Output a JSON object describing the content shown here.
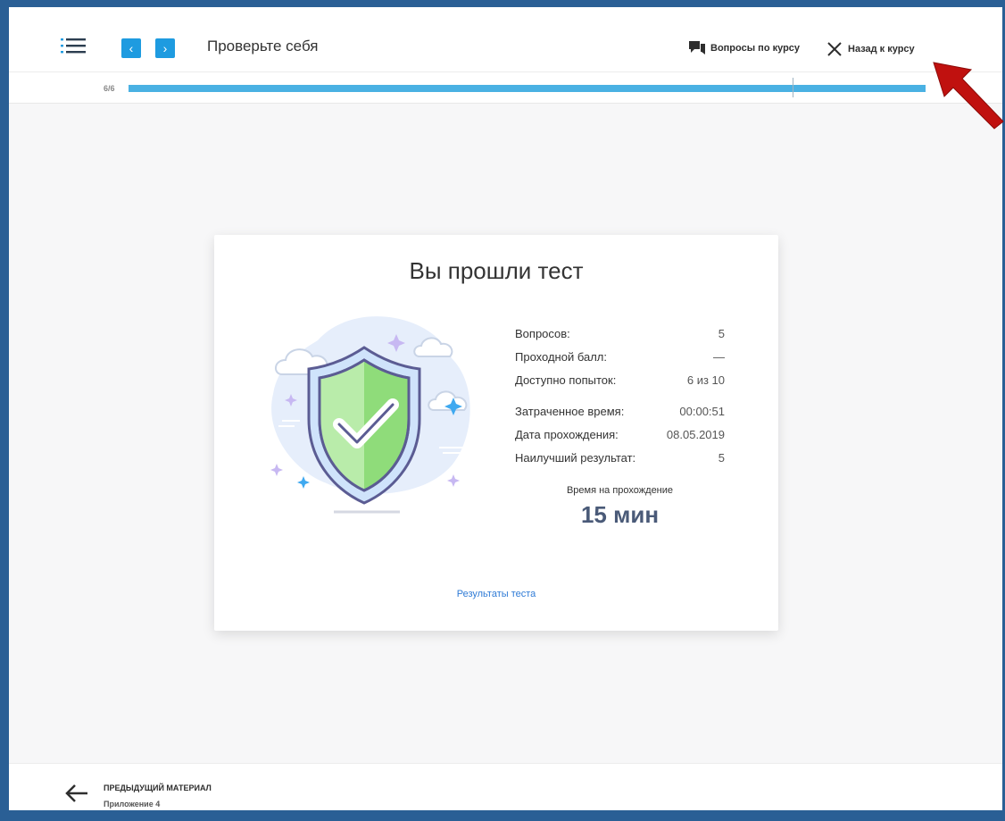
{
  "header": {
    "title": "Проверьте себя",
    "questions_label": "Вопросы по курсу",
    "back_label": "Назад к курсу"
  },
  "progress": {
    "label": "6/6",
    "fraction": 1.0,
    "color": "#4ab1e3"
  },
  "result": {
    "title": "Вы прошли тест",
    "stats": [
      {
        "label": "Вопросов:",
        "value": "5"
      },
      {
        "label": "Проходной балл:",
        "value": "—"
      },
      {
        "label": "Доступно попыток:",
        "value": "6 из 10"
      },
      {
        "label": "Затраченное время:",
        "value": "00:00:51"
      },
      {
        "label": "Дата прохождения:",
        "value": "08.05.2019"
      },
      {
        "label": "Наилучший результат:",
        "value": "5"
      }
    ],
    "time_caption": "Время на прохождение",
    "time_value": "15 мин",
    "results_link": "Результаты теста"
  },
  "footer": {
    "prev_label": "ПРЕДЫДУЩИЙ МАТЕРИАЛ",
    "prev_sub": "Приложение 4"
  },
  "icons": [
    "menu-icon",
    "chevron-left-icon",
    "chevron-right-icon",
    "chat-icon",
    "close-icon",
    "shield-check-icon",
    "arrow-left-icon"
  ],
  "colors": {
    "accent": "#1e9be0",
    "shield": "#7ed36e",
    "annotation": "#c0110f"
  }
}
